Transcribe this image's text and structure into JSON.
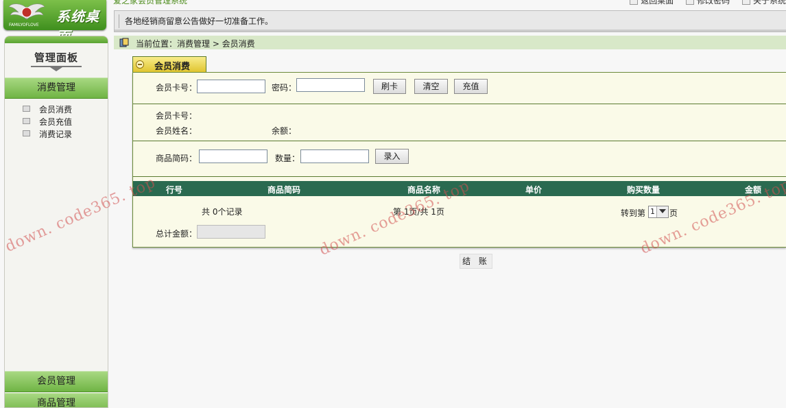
{
  "header": {
    "logo_title": "系统桌面",
    "logo_small": "FAMILYOFLOVE",
    "system_name": "爱之家会员管理系统",
    "top_links": [
      "返回桌面",
      "修改密码",
      "关于系统"
    ],
    "notice": "各地经销商留意公告做好一切准备工作。"
  },
  "sidebar": {
    "panel_title": "管理面板",
    "active_section": "消费管理",
    "items": [
      "会员消费",
      "会员充值",
      "消费记录"
    ],
    "bottom_sections": [
      "会员管理",
      "商品管理"
    ]
  },
  "breadcrumb": {
    "text": "当前位置：消费管理 > 会员消费"
  },
  "main": {
    "tab_title": "会员消费",
    "card_label": "会员卡号：",
    "password_label": "密码：",
    "card_value": "",
    "password_value": "",
    "buttons": {
      "swipe": "刷卡",
      "clear": "清空",
      "recharge": "充值",
      "enter": "录入",
      "checkout": "结 账"
    },
    "info": {
      "card_no_label": "会员卡号：",
      "name_label": "会员姓名：",
      "balance_label": "余额："
    },
    "product_code_label": "商品简码：",
    "quantity_label": "数量：",
    "product_code_value": "",
    "quantity_value": "",
    "table_headers": [
      "行号",
      "商品简码",
      "商品名称",
      "单价",
      "购买数量",
      "金额"
    ],
    "record_count": "共 0个记录",
    "page_info": "第 1页/共 1页",
    "goto_label": "转到第",
    "goto_page": "1",
    "goto_suffix": "页",
    "total_label": "总计金额：",
    "total_value": ""
  },
  "watermark": "down. code365. top",
  "colors": {
    "brand_green": "#5aa332",
    "table_header": "#2a6a50",
    "tab_yellow": "#e0c530"
  }
}
